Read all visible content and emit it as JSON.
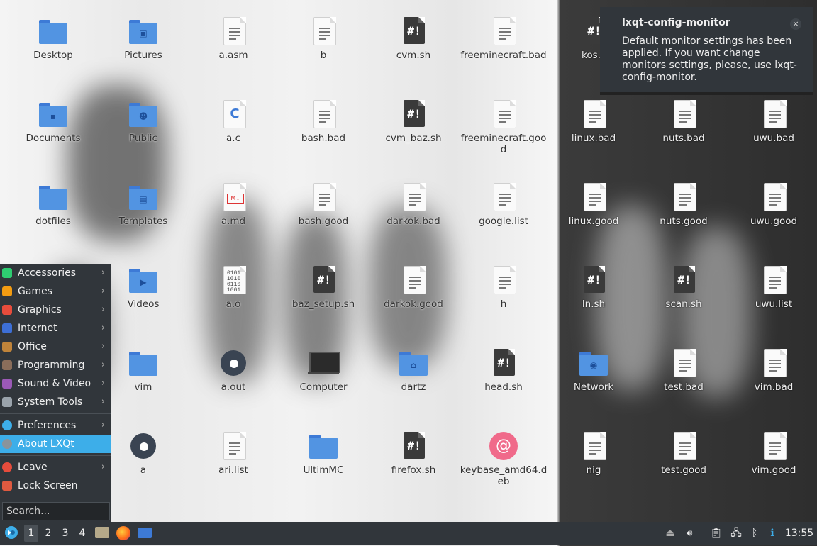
{
  "desktop": {
    "icons": [
      {
        "label": "Desktop",
        "kind": "folder",
        "badge": ""
      },
      {
        "label": "Pictures",
        "kind": "folder",
        "badge": "▣"
      },
      {
        "label": "a.asm",
        "kind": "doc"
      },
      {
        "label": "b",
        "kind": "doc"
      },
      {
        "label": "cvm.sh",
        "kind": "script"
      },
      {
        "label": "freeminecraft.bad",
        "kind": "doc"
      },
      {
        "label": "kos.s",
        "kind": "script"
      },
      {
        "label": "Documents",
        "kind": "folder",
        "badge": "▪"
      },
      {
        "label": "Public",
        "kind": "folder",
        "badge": "☻"
      },
      {
        "label": "a.c",
        "kind": "c-source"
      },
      {
        "label": "bash.bad",
        "kind": "doc"
      },
      {
        "label": "cvm_baz.sh",
        "kind": "script"
      },
      {
        "label": "freeminecraft.good",
        "kind": "doc"
      },
      {
        "label": "linux.bad",
        "kind": "doc"
      },
      {
        "label": "nuts.bad",
        "kind": "doc"
      },
      {
        "label": "uwu.bad",
        "kind": "doc"
      },
      {
        "label": "dotfiles",
        "kind": "folder",
        "badge": ""
      },
      {
        "label": "Templates",
        "kind": "folder",
        "badge": "▤"
      },
      {
        "label": "a.md",
        "kind": "markdown"
      },
      {
        "label": "bash.good",
        "kind": "doc"
      },
      {
        "label": "darkok.bad",
        "kind": "doc"
      },
      {
        "label": "google.list",
        "kind": "doc"
      },
      {
        "label": "linux.good",
        "kind": "doc"
      },
      {
        "label": "nuts.good",
        "kind": "doc"
      },
      {
        "label": "uwu.good",
        "kind": "doc"
      },
      {
        "label": "Videos",
        "kind": "folder",
        "badge": "▶"
      },
      {
        "label": "a.o",
        "kind": "binary"
      },
      {
        "label": "baz_setup.sh",
        "kind": "script"
      },
      {
        "label": "darkok.good",
        "kind": "doc"
      },
      {
        "label": "h",
        "kind": "doc"
      },
      {
        "label": "ln.sh",
        "kind": "script"
      },
      {
        "label": "scan.sh",
        "kind": "script"
      },
      {
        "label": "uwu.list",
        "kind": "doc"
      },
      {
        "label": "vim",
        "kind": "folder",
        "badge": ""
      },
      {
        "label": "a.out",
        "kind": "gear"
      },
      {
        "label": "Computer",
        "kind": "computer"
      },
      {
        "label": "dartz",
        "kind": "folder",
        "badge": "⌂"
      },
      {
        "label": "head.sh",
        "kind": "script"
      },
      {
        "label": "Network",
        "kind": "folder",
        "badge": "◉"
      },
      {
        "label": "test.bad",
        "kind": "doc"
      },
      {
        "label": "vim.bad",
        "kind": "doc"
      },
      {
        "label": "a",
        "kind": "gear"
      },
      {
        "label": "ari.list",
        "kind": "doc"
      },
      {
        "label": "UltimMC",
        "kind": "folder",
        "badge": ""
      },
      {
        "label": "firefox.sh",
        "kind": "script"
      },
      {
        "label": "keybase_amd64.deb",
        "kind": "debian"
      },
      {
        "label": "nig",
        "kind": "doc"
      },
      {
        "label": "test.good",
        "kind": "doc"
      },
      {
        "label": "vim.good",
        "kind": "doc"
      }
    ]
  },
  "notification": {
    "title": "lxqt-config-monitor",
    "body": "Default monitor settings has been applied. If you want change monitors settings, please, use lxqt-config-monitor.",
    "close": "×"
  },
  "start_menu": {
    "categories": [
      {
        "label": "Accessories",
        "color": "#2ecc71"
      },
      {
        "label": "Games",
        "color": "#f39c12"
      },
      {
        "label": "Graphics",
        "color": "#e74c3c"
      },
      {
        "label": "Internet",
        "color": "#3d6fd6"
      },
      {
        "label": "Office",
        "color": "#c0843a"
      },
      {
        "label": "Programming",
        "color": "#8a6d5a"
      },
      {
        "label": "Sound & Video",
        "color": "#9b59b6"
      },
      {
        "label": "System Tools",
        "color": "#9aa3ab"
      }
    ],
    "preferences": "Preferences",
    "about": "About LXQt",
    "leave": "Leave",
    "lock": "Lock Screen",
    "search_placeholder": "Search..."
  },
  "taskbar": {
    "workspaces": [
      "1",
      "2",
      "3",
      "4"
    ],
    "clock": "13:55"
  }
}
